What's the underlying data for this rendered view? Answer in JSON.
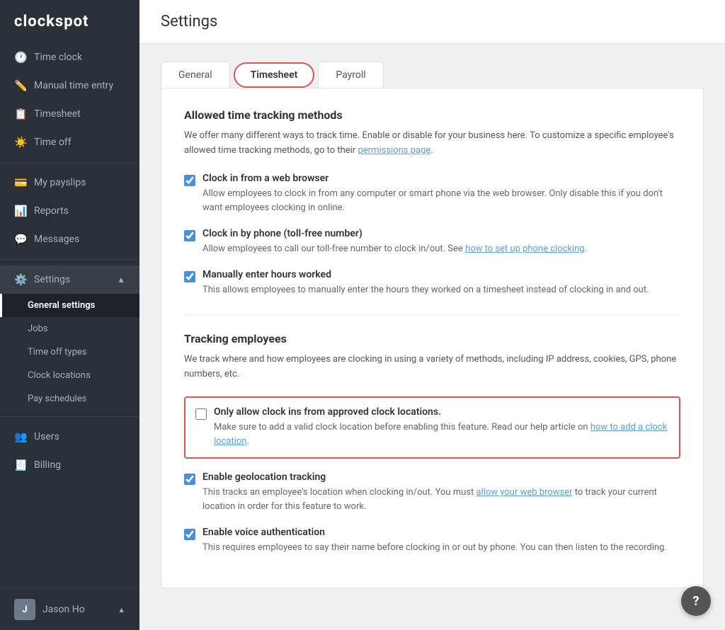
{
  "app": {
    "name": "clockspot"
  },
  "sidebar": {
    "nav_items": [
      {
        "id": "time-clock",
        "label": "Time clock",
        "icon": "🕐"
      },
      {
        "id": "manual-time-entry",
        "label": "Manual time entry",
        "icon": "✏️"
      },
      {
        "id": "timesheet",
        "label": "Timesheet",
        "icon": "📋"
      },
      {
        "id": "time-off",
        "label": "Time off",
        "icon": "☀️"
      }
    ],
    "nav_items2": [
      {
        "id": "my-payslips",
        "label": "My payslips",
        "icon": "💳"
      },
      {
        "id": "reports",
        "label": "Reports",
        "icon": "📊"
      },
      {
        "id": "messages",
        "label": "Messages",
        "icon": "💬"
      }
    ],
    "settings": {
      "label": "Settings",
      "chevron": "▲",
      "sub_items": [
        {
          "id": "general-settings",
          "label": "General settings",
          "active": true
        },
        {
          "id": "jobs",
          "label": "Jobs"
        },
        {
          "id": "time-off-types",
          "label": "Time off types"
        },
        {
          "id": "clock-locations",
          "label": "Clock locations"
        },
        {
          "id": "pay-schedules",
          "label": "Pay schedules"
        }
      ]
    },
    "bottom_items": [
      {
        "id": "users",
        "label": "Users",
        "icon": "👥"
      },
      {
        "id": "billing",
        "label": "Billing",
        "icon": "🧾"
      }
    ],
    "user": {
      "name": "Jason Ho",
      "avatar_letter": "J",
      "chevron": "▲"
    }
  },
  "header": {
    "title": "Settings"
  },
  "tabs": [
    {
      "id": "general",
      "label": "General",
      "active": false
    },
    {
      "id": "timesheet",
      "label": "Timesheet",
      "active": true
    },
    {
      "id": "payroll",
      "label": "Payroll",
      "active": false
    }
  ],
  "timesheet_settings": {
    "allowed_tracking": {
      "title": "Allowed time tracking methods",
      "description": "We offer many different ways to track time. Enable or disable for your business here. To customize a specific employee's allowed time tracking methods, go to their permissions page.",
      "options": [
        {
          "id": "clock-web",
          "label": "Clock in from a web browser",
          "checked": true,
          "description": "Allow employees to clock in from any computer or smart phone via the web browser. Only disable this if you don't want employees clocking in online."
        },
        {
          "id": "clock-phone",
          "label": "Clock in by phone (toll-free number)",
          "checked": true,
          "description": "Allow employees to call our toll-free number to clock in/out. See ",
          "link_text": "how to set up phone clocking",
          "link_after": ".",
          "description_after": ""
        },
        {
          "id": "manual-hours",
          "label": "Manually enter hours worked",
          "checked": true,
          "description": "This allows employees to manually enter the hours they worked on a timesheet instead of clocking in and out."
        }
      ]
    },
    "tracking_employees": {
      "title": "Tracking employees",
      "description": "We track where and how employees are clocking in using a variety of methods, including IP address, cookies, GPS, phone numbers, etc.",
      "options": [
        {
          "id": "approved-locations",
          "label": "Only allow clock ins from approved clock locations.",
          "checked": false,
          "highlighted": true,
          "description": "Make sure to add a valid clock location before enabling this feature. Read our help article on ",
          "link_text": "how to add a clock location",
          "description_after": "."
        },
        {
          "id": "geolocation",
          "label": "Enable geolocation tracking",
          "checked": true,
          "highlighted": false,
          "description": "This tracks an employee's location when clocking in/out. You must ",
          "link_text": "allow your web browser",
          "description_after": " to track your current location in order for this feature to work."
        },
        {
          "id": "voice-auth",
          "label": "Enable voice authentication",
          "checked": true,
          "highlighted": false,
          "description": "This requires employees to say their name before clocking in or out by phone. You can then listen to the recording."
        }
      ]
    }
  },
  "help": {
    "label": "?"
  }
}
